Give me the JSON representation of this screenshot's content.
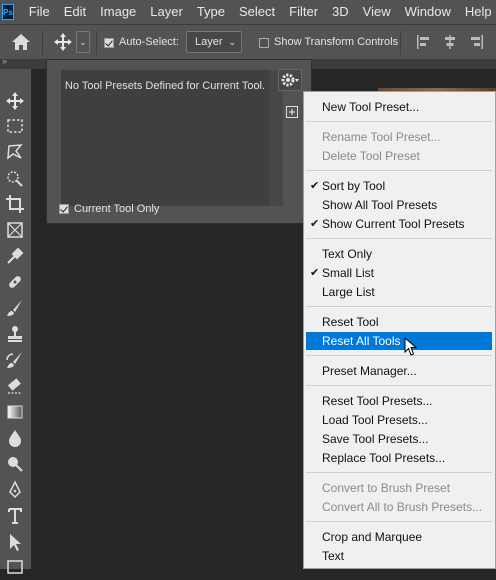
{
  "menubar": {
    "logo": "Ps",
    "items": [
      "File",
      "Edit",
      "Image",
      "Layer",
      "Type",
      "Select",
      "Filter",
      "3D",
      "View",
      "Window",
      "Help"
    ]
  },
  "options": {
    "auto_select_label": "Auto-Select:",
    "auto_select_checked": true,
    "layer_select_value": "Layer",
    "transform_label": "Show Transform Controls",
    "transform_checked": false
  },
  "panel": {
    "empty_message": "No Tool Presets Defined for Current Tool.",
    "current_tool_only_label": "Current Tool Only",
    "current_tool_only_checked": true
  },
  "context_menu": {
    "groups": [
      [
        {
          "label": "New Tool Preset...",
          "enabled": true
        }
      ],
      [
        {
          "label": "Rename Tool Preset...",
          "enabled": false
        },
        {
          "label": "Delete Tool Preset",
          "enabled": false
        }
      ],
      [
        {
          "label": "Sort by Tool",
          "enabled": true,
          "checked": true
        },
        {
          "label": "Show All Tool Presets",
          "enabled": true
        },
        {
          "label": "Show Current Tool Presets",
          "enabled": true,
          "checked": true
        }
      ],
      [
        {
          "label": "Text Only",
          "enabled": true
        },
        {
          "label": "Small List",
          "enabled": true,
          "checked": true
        },
        {
          "label": "Large List",
          "enabled": true
        }
      ],
      [
        {
          "label": "Reset Tool",
          "enabled": true
        },
        {
          "label": "Reset All Tools",
          "enabled": true,
          "highlighted": true
        }
      ],
      [
        {
          "label": "Preset Manager...",
          "enabled": true
        }
      ],
      [
        {
          "label": "Reset Tool Presets...",
          "enabled": true
        },
        {
          "label": "Load Tool Presets...",
          "enabled": true
        },
        {
          "label": "Save Tool Presets...",
          "enabled": true
        },
        {
          "label": "Replace Tool Presets...",
          "enabled": true
        }
      ],
      [
        {
          "label": "Convert to Brush Preset",
          "enabled": false
        },
        {
          "label": "Convert All to Brush Presets...",
          "enabled": false
        }
      ],
      [
        {
          "label": "Crop and Marquee",
          "enabled": true
        },
        {
          "label": "Text",
          "enabled": true
        }
      ]
    ]
  },
  "colors": {
    "highlight": "#0078d7",
    "menubar": "#535353",
    "menu_bg": "#f0f0f0"
  }
}
